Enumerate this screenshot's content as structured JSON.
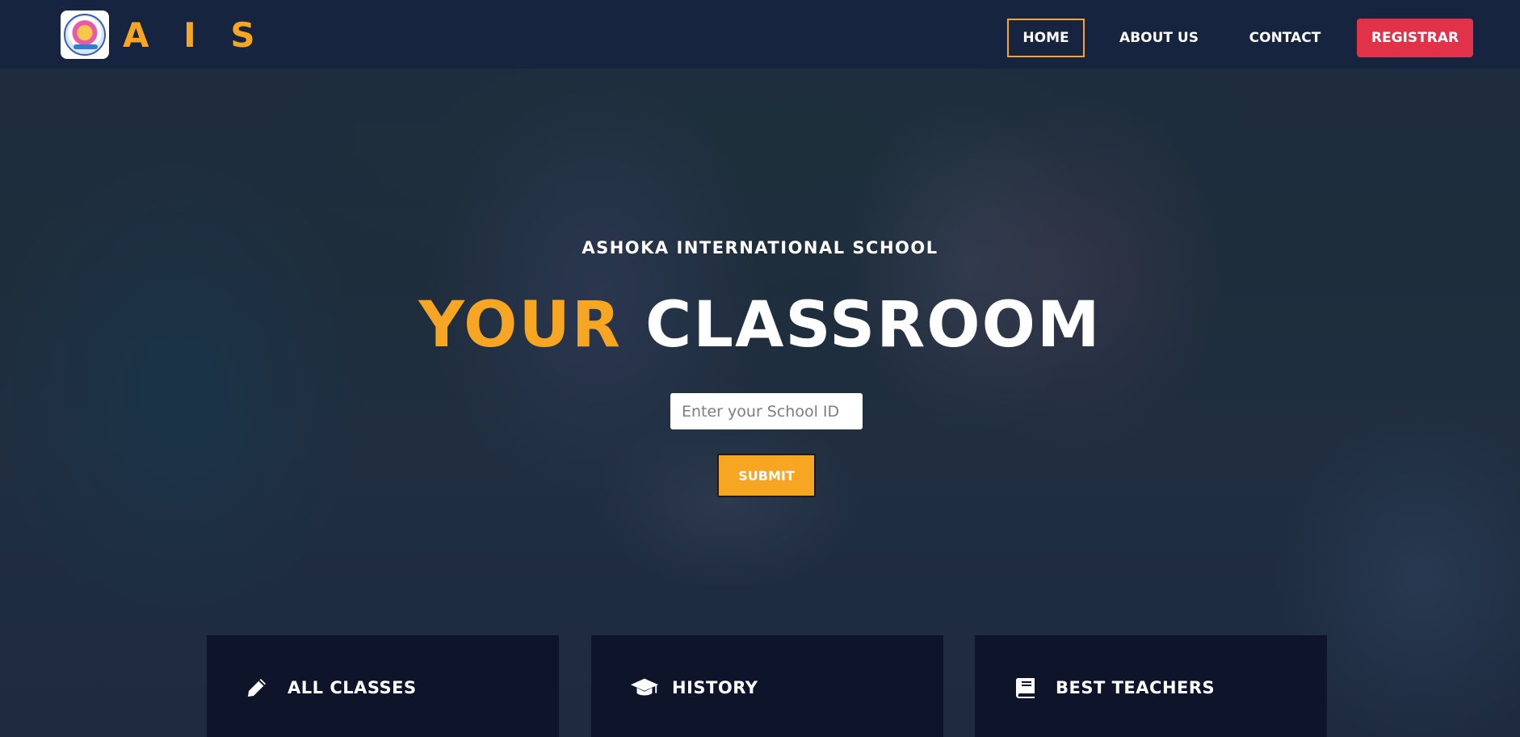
{
  "brand": {
    "logo_icon": "school-seal-logo",
    "name": "A I S"
  },
  "nav": {
    "home": "HOME",
    "about": "ABOUT US",
    "contact": "CONTACT",
    "registrar": "REGISTRAR"
  },
  "hero": {
    "school_name": "ASHOKA INTERNATIONAL SCHOOL",
    "headline_highlight": "YOUR",
    "headline_rest": "CLASSROOM",
    "input_placeholder": "Enter your School ID",
    "input_value": "",
    "submit_label": "SUBMIT"
  },
  "features": [
    {
      "icon": "pencil-icon",
      "label": "ALL CLASSES"
    },
    {
      "icon": "graduation-cap-icon",
      "label": "HISTORY"
    },
    {
      "icon": "book-icon",
      "label": "BEST TEACHERS"
    }
  ],
  "colors": {
    "accent": "#f6a623",
    "navbar": "#17243f",
    "registrar": "#e1324a",
    "card": "#0e152b"
  }
}
